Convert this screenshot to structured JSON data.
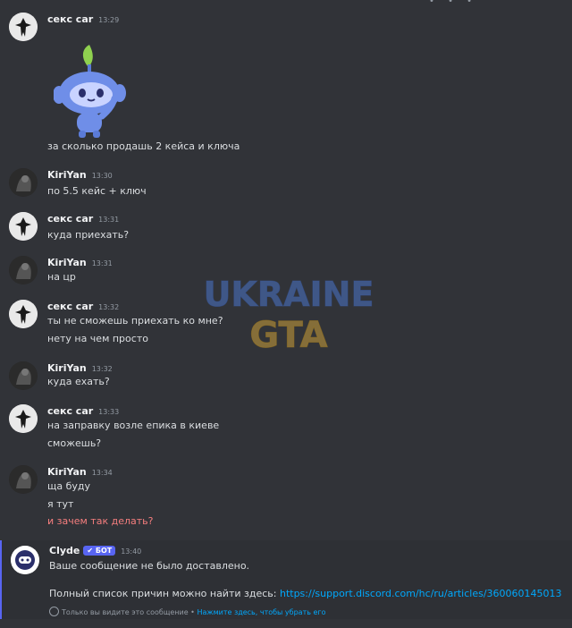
{
  "messages": [
    {
      "author": "секс car",
      "time": "13:29",
      "lines": [
        "за сколько продашь 2 кейса и ключа"
      ]
    },
    {
      "author": "KiriYan",
      "time": "13:30",
      "lines": [
        "по 5.5 кейс + ключ"
      ]
    },
    {
      "author": "секс car",
      "time": "13:31",
      "lines": [
        "куда приехать?"
      ]
    },
    {
      "author": "KiriYan",
      "time": "13:31",
      "lines": [
        "на цр"
      ]
    },
    {
      "author": "секс car",
      "time": "13:32",
      "lines": [
        "ты не сможешь приехать ко мне?",
        "нету на чем просто"
      ]
    },
    {
      "author": "KiriYan",
      "time": "13:32",
      "lines": [
        "куда ехать?"
      ]
    },
    {
      "author": "секс car",
      "time": "13:33",
      "lines": [
        "на заправку возле епика в киеве",
        "сможешь?"
      ]
    },
    {
      "author": "KiriYan",
      "time": "13:34",
      "lines": [
        "ща буду",
        "я тут",
        "и зачем так делать?"
      ]
    }
  ],
  "clyde": {
    "author": "Clyde",
    "bot_tag": "✔ БОТ",
    "time": "13:40",
    "line1": "Ваше сообщение не было доставлено.",
    "line2_prefix": "Полный список причин можно найти здесь: ",
    "link": "https://support.discord.com/hc/ru/articles/360060145013",
    "ephemeral_note": "Только вы видите это сообщение",
    "ephemeral_sep": " • ",
    "ephemeral_action": "Нажмите здесь, чтобы убрать его"
  },
  "watermark": {
    "line1": "UKRAINE",
    "line2": "GTA"
  },
  "colors": {
    "background": "#313338",
    "accent": "#5865f2",
    "link": "#00a8fc",
    "error_text": "#f57e7e"
  }
}
